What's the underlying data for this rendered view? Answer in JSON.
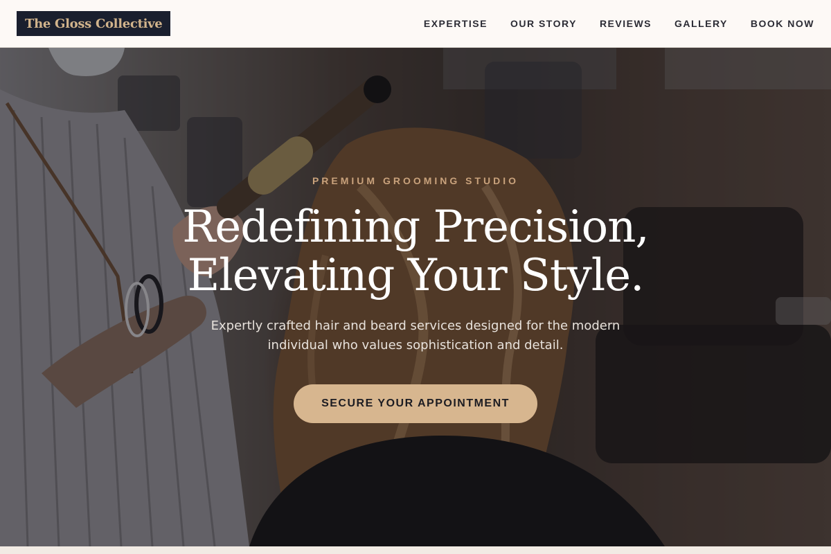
{
  "header": {
    "logo_text": "The Gloss Collective",
    "nav": [
      {
        "label": "EXPERTISE"
      },
      {
        "label": "OUR STORY"
      },
      {
        "label": "REVIEWS"
      },
      {
        "label": "GALLERY"
      },
      {
        "label": "BOOK NOW"
      }
    ]
  },
  "hero": {
    "eyebrow": "PREMIUM GROOMING STUDIO",
    "headline_line1": "Redefining Precision,",
    "headline_line2": "Elevating Your Style.",
    "subtext": "Expertly crafted hair and beard services designed for the modern individual who values sophistication and detail.",
    "cta_label": "SECURE YOUR APPOINTMENT",
    "background_image": "salon stylist curling client's hair"
  },
  "colors": {
    "accent": "#d7b68f",
    "eyebrow": "#c9a27c",
    "logo_bg": "#1a1f2e",
    "header_bg": "#fdf9f6",
    "nav_text": "#2b2b34"
  }
}
